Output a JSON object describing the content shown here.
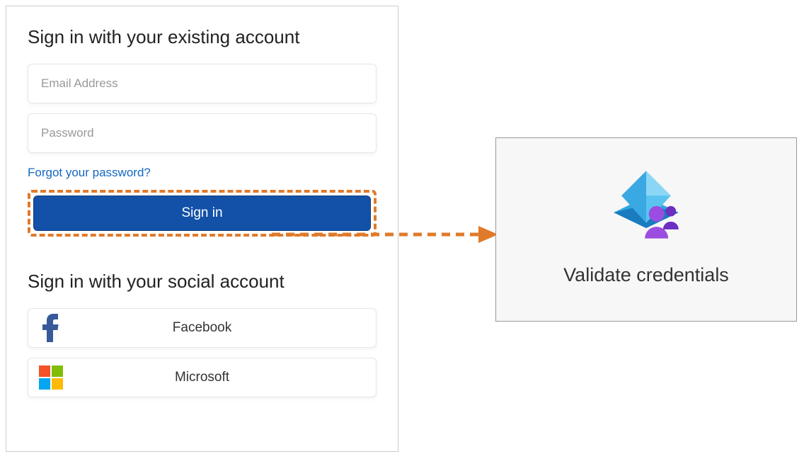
{
  "signin": {
    "heading": "Sign in with your existing account",
    "email_placeholder": "Email Address",
    "password_placeholder": "Password",
    "forgot_link": "Forgot your password?",
    "signin_button": "Sign in"
  },
  "social": {
    "heading": "Sign in with your social account",
    "providers": [
      {
        "id": "facebook",
        "label": "Facebook"
      },
      {
        "id": "microsoft",
        "label": "Microsoft"
      }
    ]
  },
  "validate": {
    "label": "Validate credentials"
  },
  "colors": {
    "highlight": "#e07a2a",
    "primary_button": "#1351a8",
    "link": "#1467c2"
  }
}
